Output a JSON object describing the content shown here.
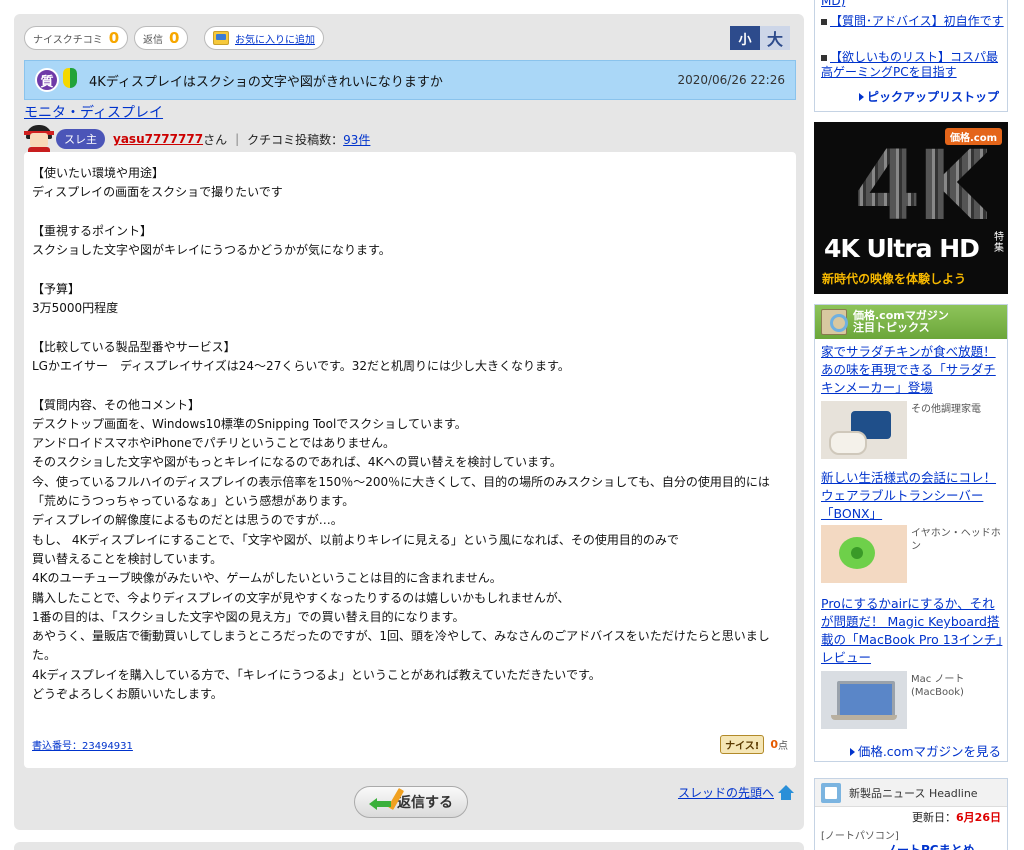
{
  "toolbar": {
    "nice_label": "ナイスクチコミ",
    "nice_count": "0",
    "reply_label": "返信",
    "reply_count": "0",
    "favorite_label": "お気に入りに追加",
    "size_small": "小",
    "size_large": "大"
  },
  "thread": {
    "q_badge": "質",
    "title": "4Kディスプレイはスクショの文字や図がきれいになりますか",
    "date": "2020/06/26 22:26",
    "category": "モニタ・ディスプレイ"
  },
  "poster": {
    "badge": "スレ主",
    "username": "yasu7777777",
    "honorific": "さん",
    "post_count_label": "クチコミ投稿数：",
    "post_count": "93件"
  },
  "post": {
    "body": "【使いたい環境や用途】\nディスプレイの画面をスクショで撮りたいです\n\n【重視するポイント】\nスクショした文字や図がキレイにうつるかどうかが気になります。\n\n【予算】\n3万5000円程度\n\n【比較している製品型番やサービス】\nLGかエイサー　ディスプレイサイズは24～27くらいです。32だと机周りには少し大きくなります。\n\n【質問内容、その他コメント】\nデスクトップ画面を、Windows10標準のSnipping Toolでスクショしています。\nアンドロイドスマホやiPhoneでパチリということではありません。\nそのスクショした文字や図がもっとキレイになるのであれば、4Kへの買い替えを検討しています。\n今、使っているフルハイのディスプレイの表示倍率を150％～200％に大きくして、目的の場所のみスクショしても、自分の使用目的には\n「荒めにうつっちゃっているなぁ」という感想があります。\nディスプレイの解像度によるものだとは思うのですが…。\nもし、 4Kディスプレイにすることで、「文字や図が、以前よりキレイに見える」という風になれば、その使用目的のみで\n買い替えることを検討しています。\n4Kのユーチューブ映像がみたいや、ゲームがしたいということは目的に含まれません。\n購入したことで、今よりディスプレイの文字が見やすくなったりするのは嬉しいかもしれませんが、\n1番の目的は、「スクショした文字や図の見え方」での買い替え目的になります。\nあやうく、量販店で衝動買いしてしまうところだったのですが、1回、頭を冷やして、みなさんのごアドバイスをいただけたらと思いました。\n4kディスプレイを購入している方で、「キレイにうつるよ」ということがあれば教えていただきたいです。\nどうぞよろしくお願いいたします。",
    "post_number": "書込番号：23494931",
    "nice_button": "ナイス!",
    "nice_points": "0",
    "nice_unit": "点"
  },
  "actions": {
    "reply_button": "返信する",
    "thread_top": "スレッドの先頭へ"
  },
  "sidebar": {
    "pickup_items": [
      "MD)",
      "【質問･アドバイス】初自作です",
      "【欲しいものリスト】コスパ最高ゲーミングPCを目指す"
    ],
    "pickup_more": "ピックアップリストップ",
    "banner": {
      "logo": "価格.com",
      "big": "4K",
      "uhd": "4K Ultra HD",
      "special": "特集",
      "sub": "新時代の映像を体験しよう"
    },
    "magazine": {
      "title_line1": "価格.comマガジン",
      "title_line2": "注目トピックス",
      "articles": [
        {
          "title": "家でサラダチキンが食べ放題！ あの味を再現できる「サラダチキンメーカー」登場",
          "category": "その他調理家電"
        },
        {
          "title": "新しい生活様式の会話にコレ！ ウェアラブルトランシーバー「BONX」",
          "category": "イヤホン・ヘッドホン"
        },
        {
          "title": "Proにするかairにするか、それが問題だ！ Magic Keyboard搭載の「MacBook Pro 13インチ」レビュー",
          "category": "Mac ノート(MacBook)"
        }
      ],
      "more": "価格.comマガジンを見る"
    },
    "news": {
      "title": "新製品ニュース Headline",
      "updated_label": "更新日：",
      "updated_date": "6月26日",
      "category": "[ノートパソコン]",
      "link": "ノートPCまとめ"
    }
  }
}
